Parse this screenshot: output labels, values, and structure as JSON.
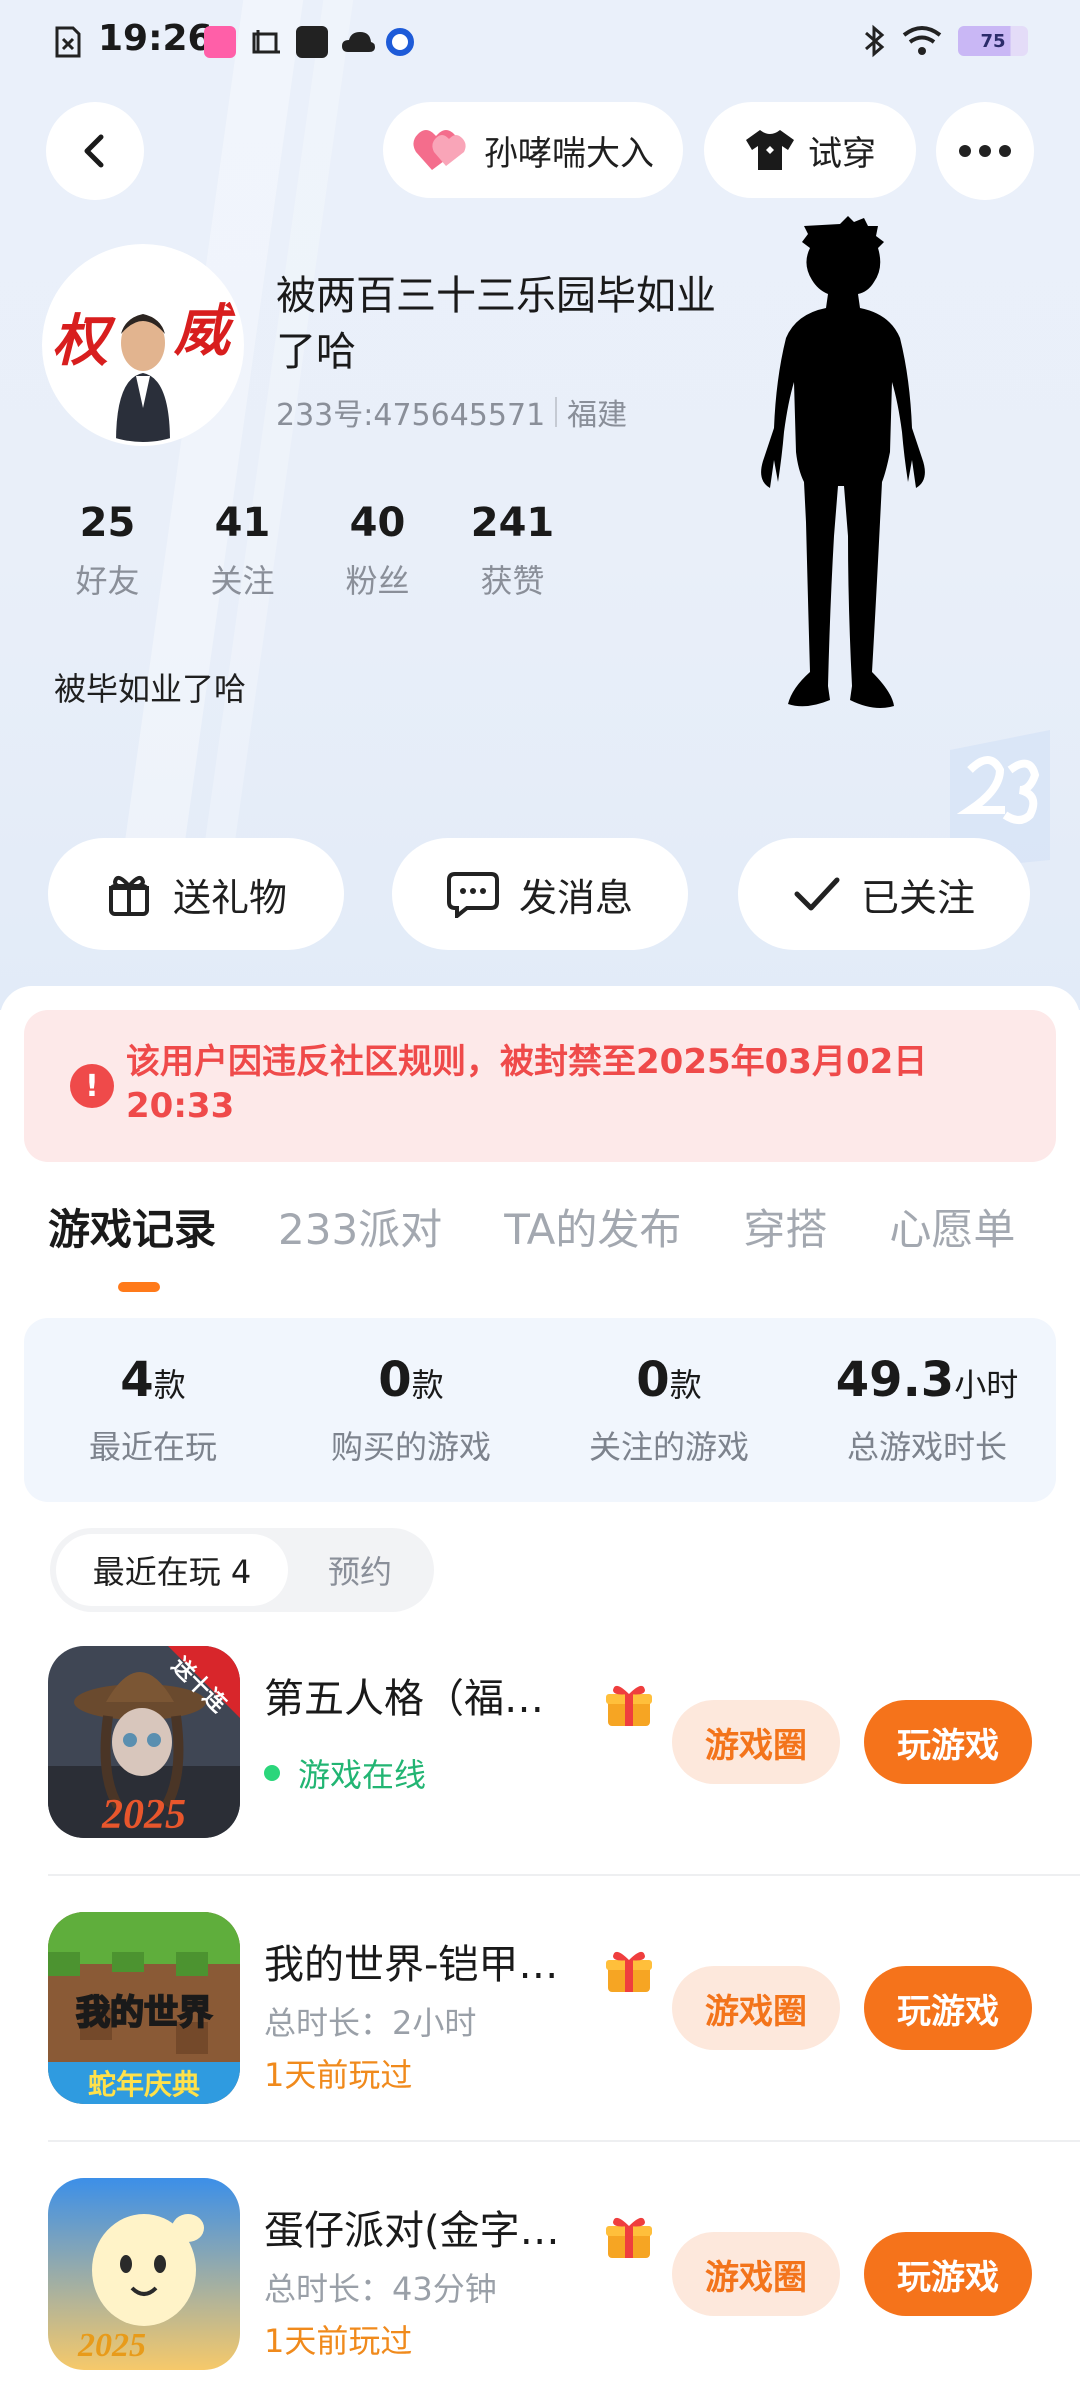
{
  "status_bar": {
    "time": "19:26",
    "battery": "75"
  },
  "header": {
    "owner_pill_label": "孙哮喘大入",
    "try_on_label": "试穿"
  },
  "profile": {
    "avatar_text": "权威",
    "name": "被两百三十三乐园毕如业了哈",
    "uid": "233号:475645571",
    "region": "福建",
    "bio": "被毕如业了哈",
    "stats": [
      {
        "value": "25",
        "label": "好友"
      },
      {
        "value": "41",
        "label": "关注"
      },
      {
        "value": "40",
        "label": "粉丝"
      },
      {
        "value": "241",
        "label": "获赞"
      }
    ]
  },
  "actions": {
    "gift": "送礼物",
    "message": "发消息",
    "follow": "已关注"
  },
  "ban_notice": "该用户因违反社区规则，被封禁至2025年03月02日 20:33",
  "tabs": [
    "游戏记录",
    "233派对",
    "TA的发布",
    "穿搭",
    "心愿单"
  ],
  "summary": [
    {
      "value": "4",
      "unit": "款",
      "label": "最近在玩"
    },
    {
      "value": "0",
      "unit": "款",
      "label": "购买的游戏"
    },
    {
      "value": "0",
      "unit": "款",
      "label": "关注的游戏"
    },
    {
      "value": "49.3",
      "unit": "小时",
      "label": "总游戏时长"
    }
  ],
  "segments": {
    "active": "最近在玩 4",
    "other": "预约"
  },
  "games": [
    {
      "title": "第五人格（福…",
      "status": "游戏在线",
      "badge": "送十连",
      "year": "2025",
      "circle_btn": "游戏圈",
      "play_btn": "玩游戏"
    },
    {
      "title": "我的世界-铠甲…",
      "duration": "总时长：2小时",
      "recent": "1天前玩过",
      "banner_top": "我的世界",
      "banner_bottom": "蛇年庆典",
      "circle_btn": "游戏圈",
      "play_btn": "玩游戏"
    },
    {
      "title": "蛋仔派对(金字…",
      "duration": "总时长：43分钟",
      "recent": "1天前玩过",
      "year": "2025",
      "circle_btn": "游戏圈",
      "play_btn": "玩游戏"
    }
  ],
  "colors": {
    "accent": "#f5731b",
    "ban": "#ef4a4a",
    "online": "#22b573"
  }
}
